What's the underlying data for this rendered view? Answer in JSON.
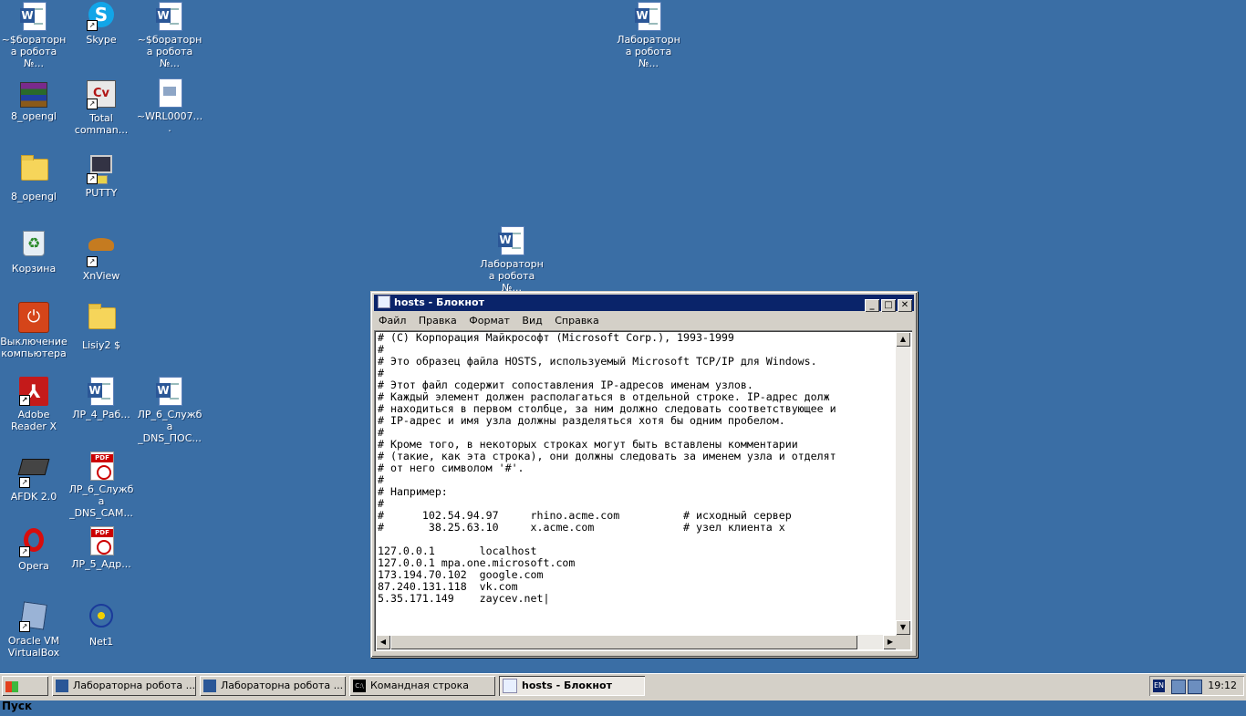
{
  "desktop": {
    "icons": [
      {
        "label": "~$бораторна робота №...",
        "type": "word"
      },
      {
        "label": "Skype",
        "type": "skype"
      },
      {
        "label": "~$бораторна робота №...",
        "type": "word"
      },
      {
        "label": "Лабораторна робота №...",
        "type": "word"
      },
      {
        "label": "8_opengl",
        "type": "archive"
      },
      {
        "label": "Total comman...",
        "type": "totalcmd"
      },
      {
        "label": "~WRL0007....",
        "type": "wrl"
      },
      {
        "label": "8_opengl",
        "type": "folder"
      },
      {
        "label": "PUTTY",
        "type": "putty"
      },
      {
        "label": "Корзина",
        "type": "recycle"
      },
      {
        "label": "XnView",
        "type": "xnview"
      },
      {
        "label": "Лабораторна робота №...",
        "type": "word"
      },
      {
        "label": "Выключение компьютера",
        "type": "shutdown"
      },
      {
        "label": "Lisiy2 $",
        "type": "folder"
      },
      {
        "label": "Adobe Reader X",
        "type": "adobe"
      },
      {
        "label": "ЛР_4_Раб...",
        "type": "word"
      },
      {
        "label": "ЛР_6_Служба _DNS_ПОС...",
        "type": "word"
      },
      {
        "label": "AFDK 2.0",
        "type": "chip"
      },
      {
        "label": "ЛР_6_Служба _DNS_САМ...",
        "type": "pdf"
      },
      {
        "label": "Opera",
        "type": "opera"
      },
      {
        "label": "ЛР_5_Адр...",
        "type": "pdf"
      },
      {
        "label": "Oracle VM VirtualBox",
        "type": "vbox"
      },
      {
        "label": "Net1",
        "type": "net1"
      }
    ]
  },
  "notepad": {
    "title": "hosts - Блокнот",
    "menu": [
      "Файл",
      "Правка",
      "Формат",
      "Вид",
      "Справка"
    ],
    "content": "# (C) Корпорация Майкрософт (Microsoft Corp.), 1993-1999\n#\n# Это образец файла HOSTS, используемый Microsoft TCP/IP для Windows.\n#\n# Этот файл содержит сопоставления IP-адресов именам узлов.\n# Каждый элемент должен располагаться в отдельной строке. IP-адрес долж\n# находиться в первом столбце, за ним должно следовать соответствующее и\n# IP-адрес и имя узла должны разделяться хотя бы одним пробелом.\n#\n# Кроме того, в некоторых строках могут быть вставлены комментарии\n# (такие, как эта строка), они должны следовать за именем узла и отделят\n# от него символом '#'.\n#\n# Например:\n#\n#      102.54.94.97     rhino.acme.com          # исходный сервер\n#       38.25.63.10     x.acme.com              # узел клиента x\n\n127.0.0.1       localhost\n127.0.0.1 mpa.one.microsoft.com\n173.194.70.102  google.com\n87.240.131.118  vk.com\n5.35.171.149    zaycev.net|"
  },
  "taskbar": {
    "start_label": "Пуск",
    "tasks": [
      {
        "label": "Лабораторна робота ...",
        "icon": "word"
      },
      {
        "label": "Лабораторна робота ...",
        "icon": "word"
      },
      {
        "label": "Командная строка",
        "icon": "cmd"
      },
      {
        "label": "hosts - Блокнот",
        "icon": "notepad",
        "active": true
      }
    ],
    "lang": "EN",
    "clock": "19:12"
  }
}
